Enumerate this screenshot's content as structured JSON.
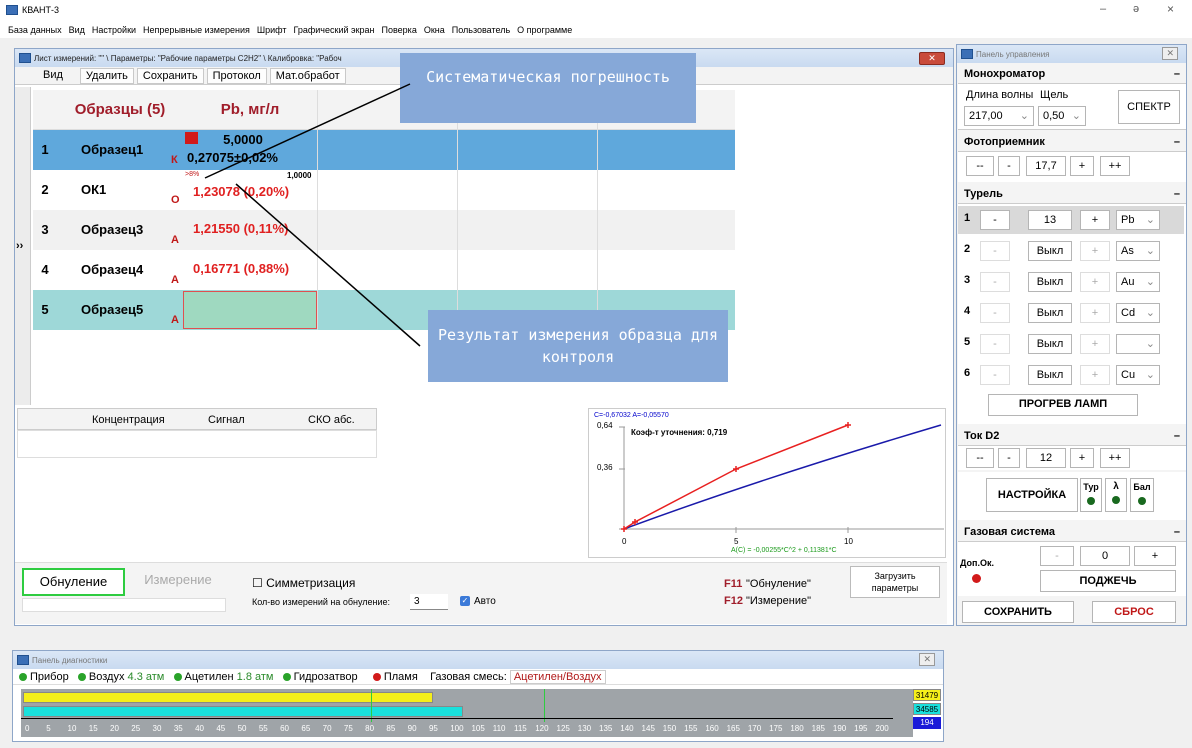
{
  "app": {
    "title": "КВАНТ-3",
    "win_controls": [
      "–",
      "ə",
      "×"
    ]
  },
  "menu": [
    "База данных",
    "Вид",
    "Настройки",
    "Непрерывные измерения",
    "Шрифт",
    "Графический экран",
    "Поверка",
    "Окна",
    "Пользователь",
    "О программе"
  ],
  "sheet": {
    "title": "Лист измерений: \"\" \\ Параметры: \"Рабочие параметры С2Н2\" \\ Калибровка: \"Рабоч",
    "toolbar": {
      "view": "Вид",
      "delete": "Удалить",
      "save": "Сохранить",
      "protocol": "Протокол",
      "math": "Мат.обработ"
    },
    "header": {
      "samples": "Образцы (5)",
      "element": "Pb, мг/л"
    },
    "rows": [
      {
        "n": "1",
        "name": "Образец1",
        "flag": "К",
        "val": "5,0000",
        "val2": "0,27075±0,02%",
        "color": "#5fa8dc"
      },
      {
        "n": "2",
        "name": "ОК1",
        "flag": "О",
        "val": "1,23078 (0,20%)",
        "note": ">8%",
        "ref": "1,0000",
        "color": "#ffffff"
      },
      {
        "n": "3",
        "name": "Образец3",
        "flag": "А",
        "val": "1,21550 (0,11%)",
        "color": "#f1f1f1"
      },
      {
        "n": "4",
        "name": "Образец4",
        "flag": "А",
        "val": "0,16771 (0,88%)",
        "color": "#ffffff"
      },
      {
        "n": "5",
        "name": "Образец5",
        "flag": "А",
        "val": "",
        "color": "#9ed8d8"
      }
    ],
    "callout1": "Систематическая погрешность",
    "callout2": "Результат измерения образца для контроля",
    "subtable": {
      "h1": "Концентрация",
      "h2": "Сигнал",
      "h3": "СКО абс."
    },
    "graph": {
      "top": "C=-0,67032 A=-0,05570",
      "coef": "Коэф-т уточнения: 0,719",
      "y1": "0,64",
      "y2": "0,36",
      "x0": "0",
      "x1": "5",
      "x2": "10",
      "formula": "A(C) = -0,00255*C^2 + 0,11381*C"
    },
    "bottom": {
      "zero": "Обнуление",
      "measure": "Измерение",
      "sym": "☐ Симметризация",
      "count_label": "Кол-во измерений на обнуление:",
      "count": "3",
      "auto": "Авто",
      "f11": "F11",
      "f11t": "\"Обнуление\"",
      "f12": "F12",
      "f12t": "\"Измерение\"",
      "load": "Загрузить параметры"
    }
  },
  "panel": {
    "title": "Панель управления",
    "mono": "Монохроматор",
    "wave_label": "Длина волны",
    "slit_label": "Щель",
    "wave": "217,00",
    "slit": "0,50",
    "spectr": "СПЕКТР",
    "photo": "Фотоприемник",
    "photo_val": "17,7",
    "turret": "Турель",
    "tur": [
      {
        "n": "1",
        "v": "13",
        "el": "Pb"
      },
      {
        "n": "2",
        "v": "Выкл",
        "el": "As"
      },
      {
        "n": "3",
        "v": "Выкл",
        "el": "Au"
      },
      {
        "n": "4",
        "v": "Выкл",
        "el": "Cd"
      },
      {
        "n": "5",
        "v": "Выкл",
        "el": ""
      },
      {
        "n": "6",
        "v": "Выкл",
        "el": "Cu"
      }
    ],
    "warm": "ПРОГРЕВ ЛАМП",
    "d2": "Ток D2",
    "d2_val": "12",
    "setup": "НАСТРОЙКА",
    "tur_s": "Тур",
    "lam": "λ",
    "bal": "Бал",
    "gas": "Газовая система",
    "dopok": "Доп.Ок.",
    "gas_val": "0",
    "ignite": "ПОДЖЕЧЬ",
    "save": "СОХРАНИТЬ",
    "reset": "СБРОС"
  },
  "diag": {
    "title": "Панель диагностики",
    "items": [
      "Прибор",
      "Воздух",
      "Ацетилен",
      "Гидрозатвор",
      "Пламя"
    ],
    "air": "4.3 атм",
    "acet": "1.8 атм",
    "mix_label": "Газовая смесь:",
    "mix": "Ацетилен/Воздух",
    "v1": "31479",
    "v2": "34585",
    "v3": "194",
    "scale": [
      "0",
      "5",
      "10",
      "15",
      "20",
      "25",
      "30",
      "35",
      "40",
      "45",
      "50",
      "55",
      "60",
      "65",
      "70",
      "75",
      "80",
      "85",
      "90",
      "95",
      "100",
      "105",
      "110",
      "115",
      "120",
      "125",
      "130",
      "135",
      "140",
      "145",
      "150",
      "155",
      "160",
      "165",
      "170",
      "175",
      "180",
      "185",
      "190",
      "195",
      "200"
    ],
    "yellow_frac": 0.47,
    "cyan_frac": 0.505
  }
}
